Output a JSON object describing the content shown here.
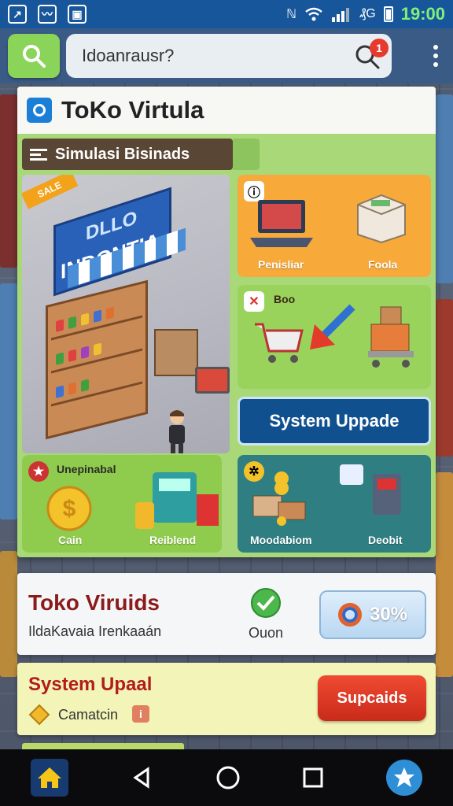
{
  "status_bar": {
    "network": "ℕ",
    "carrier": "₰G",
    "time": "19:00"
  },
  "search": {
    "value": "Idoanrausr?",
    "notification_count": "1"
  },
  "main_card": {
    "title": "ToKo Virtula",
    "sim_label": "Simulasi Bisinads",
    "store": {
      "sign_line1": "DLLO",
      "sign_line2": "INDONTIA",
      "sale_tag": "SALE"
    },
    "tiles": {
      "laptop_box": {
        "left_label": "Penisliar",
        "right_label": "Foola"
      },
      "cart_transfer": {
        "badge_label": "Boo"
      },
      "system_button": "System Uppade",
      "coins": {
        "header": "Unepinabal",
        "left_label": "Cain",
        "right_label": "Reiblend"
      },
      "shipping": {
        "left_label": "Moodabiom",
        "right_label": "Deobit"
      }
    }
  },
  "info_card": {
    "title": "Toko Viruids",
    "subtitle": "IldaKavaia Irenkaaán",
    "status": "Ouon",
    "percent": "30%"
  },
  "update_card": {
    "title": "System Upaal",
    "subtitle": "Camatcin",
    "button": "Supcaids"
  },
  "colors": {
    "accent_blue": "#17569b",
    "green_panel": "#a9d878",
    "red_button": "#d9341f"
  }
}
